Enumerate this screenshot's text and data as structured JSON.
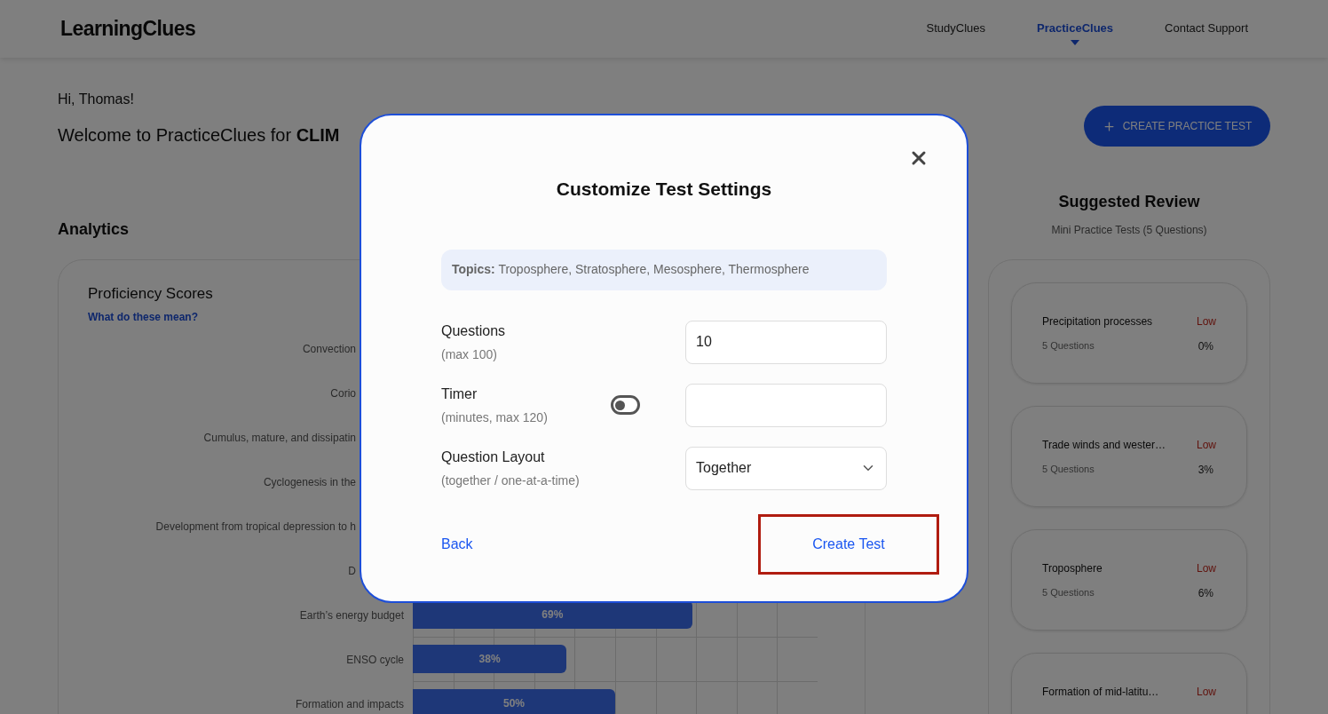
{
  "header": {
    "logo": "LearningClues",
    "nav": [
      {
        "label": "StudyClues",
        "selected": false
      },
      {
        "label": "PracticeClues",
        "selected": true
      },
      {
        "label": "Contact Support",
        "selected": false
      }
    ]
  },
  "greeting": "Hi, Thomas!",
  "welcome": "Welcome to PracticeClues for **CLIM**",
  "create_button": "CREATE PRACTICE TEST",
  "analytics": {
    "title": "Analytics",
    "card_title": "Proficiency Scores",
    "help_link": "What do these mean?",
    "rows": [
      {
        "kind": "covered",
        "label": "Convection"
      },
      {
        "kind": "covered",
        "label": "Corio"
      },
      {
        "kind": "covered",
        "label": "Cumulus, mature, and dissipatin"
      },
      {
        "kind": "covered",
        "label": "Cyclogenesis in the"
      },
      {
        "kind": "covered",
        "label": "Development from tropical depression to h"
      },
      {
        "kind": "covered",
        "label": "D"
      },
      {
        "kind": "bar",
        "label": "Earth’s energy budget",
        "level": 0.69,
        "bar_label": "69%"
      },
      {
        "kind": "bar",
        "label": "ENSO cycle",
        "level": 0.38,
        "bar_label": "38%"
      },
      {
        "kind": "bar",
        "label": "Formation and impacts",
        "level": 0.5,
        "bar_label": "50%"
      }
    ]
  },
  "suggested": {
    "title": "Suggested Review",
    "subtitle": "Mini Practice Tests (5 Questions)",
    "items": [
      {
        "name": "Precipitation processes",
        "rating": "Low",
        "questions": "5 Questions",
        "score": "0%"
      },
      {
        "name": "Trade winds and wester…",
        "rating": "Low",
        "questions": "5 Questions",
        "score": "3%"
      },
      {
        "name": "Troposphere",
        "rating": "Low",
        "questions": "5 Questions",
        "score": "6%"
      },
      {
        "name": "Formation of mid-latitu…",
        "rating": "Low"
      }
    ]
  },
  "dialog": {
    "title": "Customize Test Settings",
    "topics_label": "Topics:",
    "topics": "Troposphere, Stratosphere, Mesosphere, Thermosphere",
    "fields": [
      {
        "kind": "number",
        "label": "Questions",
        "hint": "(max 100)",
        "value": "10"
      },
      {
        "kind": "timer",
        "label": "Timer",
        "hint": "(minutes, max 120)",
        "on": false
      },
      {
        "kind": "select",
        "label": "Question Layout",
        "hint": "(together / one-at-a-time)",
        "value": "Together"
      }
    ],
    "back": "Back",
    "create": "Create Test"
  }
}
